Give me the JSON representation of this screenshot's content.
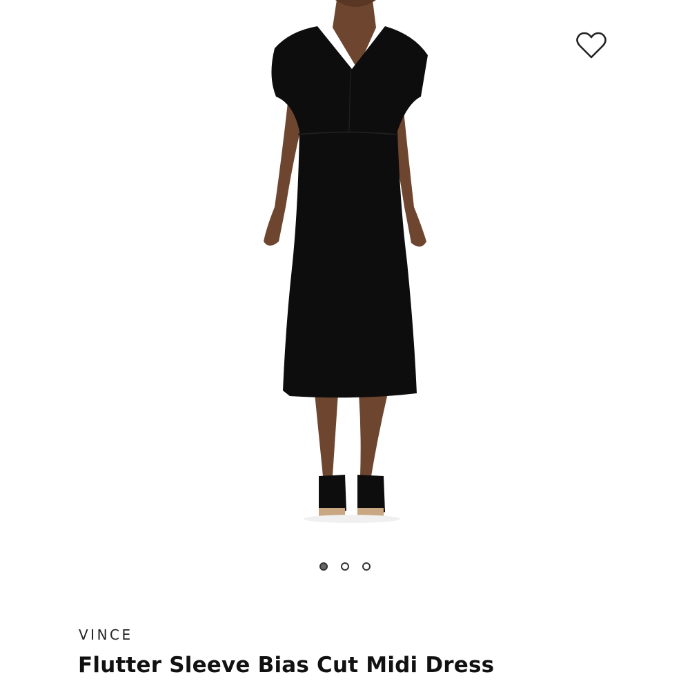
{
  "product": {
    "brand": "VINCE",
    "title": "Flutter Sleeve Bias Cut Midi Dress",
    "image_alt": "Model wearing black flutter sleeve midi dress"
  },
  "wishlist": {
    "icon": "heart-outline-icon",
    "aria_label": "Add to wishlist"
  },
  "carousel": {
    "total": 3,
    "active_index": 0
  },
  "colors": {
    "background": "#ffffff",
    "dress": "#0d0d0d",
    "skin": "#6e4630",
    "dot_active": "#666666",
    "text": "#111111"
  }
}
